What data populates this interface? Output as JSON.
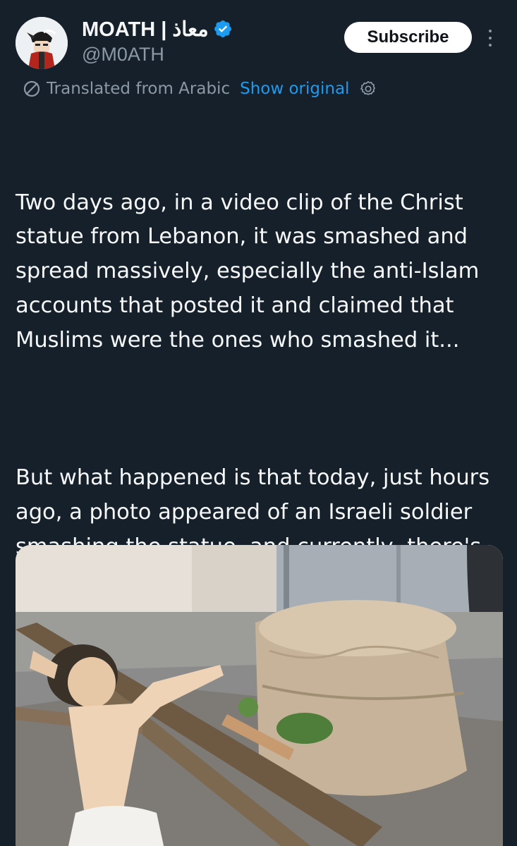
{
  "author": {
    "display_name": "MOATH | معاذ",
    "handle": "@M0ATH",
    "verified": true,
    "avatar_icon": "avatar-illustration"
  },
  "actions": {
    "subscribe_label": "Subscribe",
    "more_icon": "more-vertical-icon"
  },
  "translation": {
    "notice": "Translated from Arabic",
    "show_original_label": "Show original",
    "icon": "translate-icon",
    "settings_icon": "gear-icon"
  },
  "post": {
    "paragraphs": [
      "Two days ago, in a video clip of the Christ statue from Lebanon, it was smashed and spread massively, especially the anti-Islam accounts that posted it and claimed that Muslims were the ones who smashed it...",
      "But what happened is that today, just hours ago, a photo appeared of an Israeli soldier smashing the statue, and currently, there's outrage in Christian circles against them."
    ]
  },
  "media": {
    "type": "photo"
  },
  "colors": {
    "background": "#15202b",
    "text": "#f7f9f9",
    "secondary_text": "#8b98a5",
    "link": "#1d9bf0",
    "verified_badge": "#1d9bf0",
    "button_bg": "#ffffff",
    "button_text": "#0f1419"
  }
}
